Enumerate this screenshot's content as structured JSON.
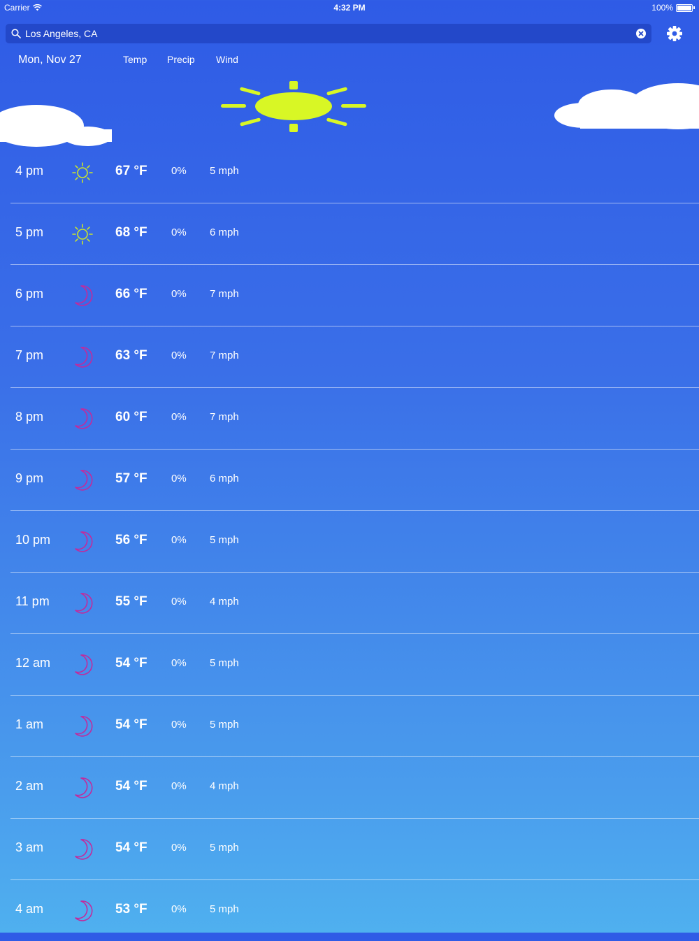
{
  "status": {
    "carrier": "Carrier",
    "time": "4:32 PM",
    "battery": "100%"
  },
  "search": {
    "value": "Los Angeles, CA",
    "placeholder": ""
  },
  "header": {
    "date": "Mon, Nov 27",
    "temp": "Temp",
    "precip": "Precip",
    "wind": "Wind"
  },
  "colors": {
    "sun": "#d8f725",
    "sun_icon": "#c9e52b",
    "moon": "#c22a9c",
    "cloud": "#ffffff"
  },
  "hours": [
    {
      "time": "4 pm",
      "icon": "sun-icon",
      "temp": "67 °F",
      "precip": "0%",
      "wind": "5 mph"
    },
    {
      "time": "5 pm",
      "icon": "sun-icon",
      "temp": "68 °F",
      "precip": "0%",
      "wind": "6 mph"
    },
    {
      "time": "6 pm",
      "icon": "moon-icon",
      "temp": "66 °F",
      "precip": "0%",
      "wind": "7 mph"
    },
    {
      "time": "7 pm",
      "icon": "moon-icon",
      "temp": "63 °F",
      "precip": "0%",
      "wind": "7 mph"
    },
    {
      "time": "8 pm",
      "icon": "moon-icon",
      "temp": "60 °F",
      "precip": "0%",
      "wind": "7 mph"
    },
    {
      "time": "9 pm",
      "icon": "moon-icon",
      "temp": "57 °F",
      "precip": "0%",
      "wind": "6 mph"
    },
    {
      "time": "10 pm",
      "icon": "moon-icon",
      "temp": "56 °F",
      "precip": "0%",
      "wind": "5 mph"
    },
    {
      "time": "11 pm",
      "icon": "moon-icon",
      "temp": "55 °F",
      "precip": "0%",
      "wind": "4 mph"
    },
    {
      "time": "12 am",
      "icon": "moon-icon",
      "temp": "54 °F",
      "precip": "0%",
      "wind": "5 mph"
    },
    {
      "time": "1 am",
      "icon": "moon-icon",
      "temp": "54 °F",
      "precip": "0%",
      "wind": "5 mph"
    },
    {
      "time": "2 am",
      "icon": "moon-icon",
      "temp": "54 °F",
      "precip": "0%",
      "wind": "4 mph"
    },
    {
      "time": "3 am",
      "icon": "moon-icon",
      "temp": "54 °F",
      "precip": "0%",
      "wind": "5 mph"
    },
    {
      "time": "4 am",
      "icon": "moon-icon",
      "temp": "53 °F",
      "precip": "0%",
      "wind": "5 mph"
    }
  ]
}
